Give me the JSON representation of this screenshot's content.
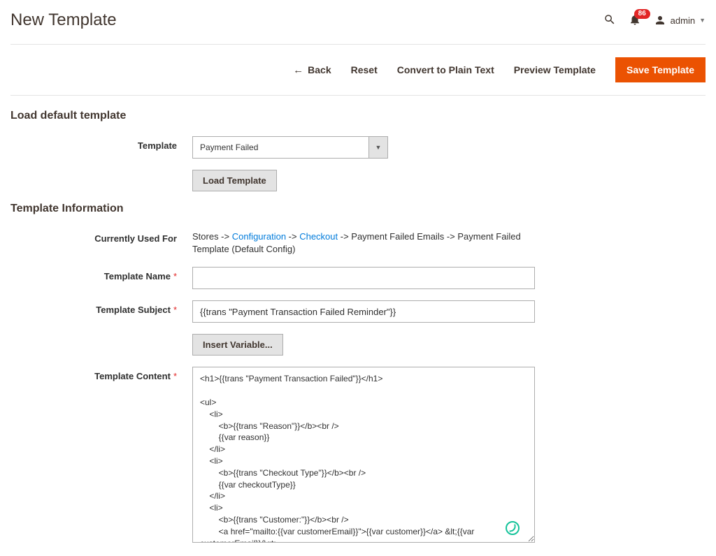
{
  "header": {
    "title": "New Template",
    "badge_count": "86",
    "username": "admin"
  },
  "actions": {
    "back": "Back",
    "reset": "Reset",
    "convert": "Convert to Plain Text",
    "preview": "Preview Template",
    "save": "Save Template"
  },
  "sections": {
    "load": "Load default template",
    "info": "Template Information"
  },
  "load": {
    "template_label": "Template",
    "template_value": "Payment Failed",
    "load_btn": "Load Template"
  },
  "info": {
    "used_for_label": "Currently Used For",
    "path_prefix": "Stores -> ",
    "path_link1": "Configuration",
    "path_sep1": " -> ",
    "path_link2": "Checkout",
    "path_suffix": " -> Payment Failed Emails -> Payment Failed Template  (Default Config)",
    "name_label": "Template Name",
    "name_value": "",
    "subject_label": "Template Subject",
    "subject_value": "{{trans \"Payment Transaction Failed Reminder\"}}",
    "insert_var_btn": "Insert Variable...",
    "content_label": "Template Content",
    "content_value": "<h1>{{trans \"Payment Transaction Failed\"}}</h1>\n\n<ul>\n    <li>\n        <b>{{trans \"Reason\"}}</b><br />\n        {{var reason}}\n    </li>\n    <li>\n        <b>{{trans \"Checkout Type\"}}</b><br />\n        {{var checkoutType}}\n    </li>\n    <li>\n        <b>{{trans \"Customer:\"}}</b><br />\n        <a href=\"mailto:{{var customerEmail}}\">{{var customer}}</a> &lt;{{var customerEmail}}&gt;\n    </li>\n    <li>\n        <b>{{trans \"Items\"}}</b><br />\n        {{var items|raw}}\n    </li>\n    <li>"
  }
}
